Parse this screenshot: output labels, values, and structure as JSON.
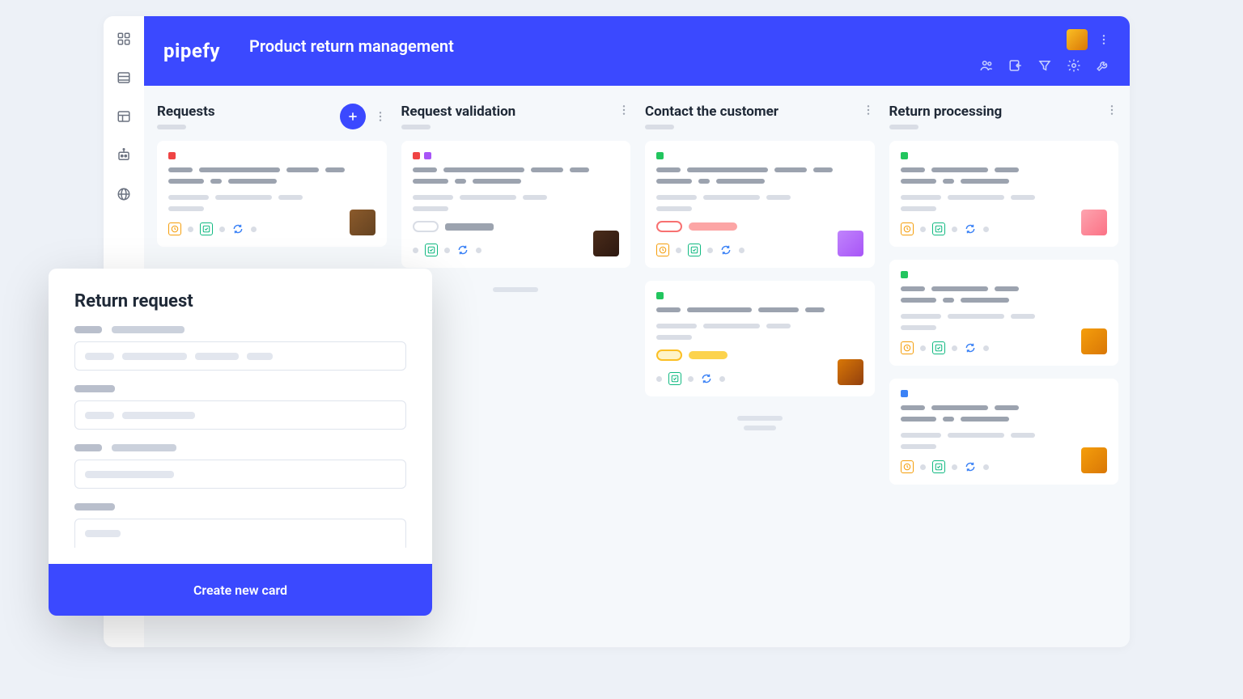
{
  "header": {
    "logo": "pipefy",
    "title": "Product return management"
  },
  "columns": [
    {
      "title": "Requests",
      "has_add": true
    },
    {
      "title": "Request validation",
      "has_add": false
    },
    {
      "title": "Contact the customer",
      "has_add": false
    },
    {
      "title": "Return processing",
      "has_add": false
    }
  ],
  "modal": {
    "title": "Return request",
    "action": "Create new card"
  }
}
